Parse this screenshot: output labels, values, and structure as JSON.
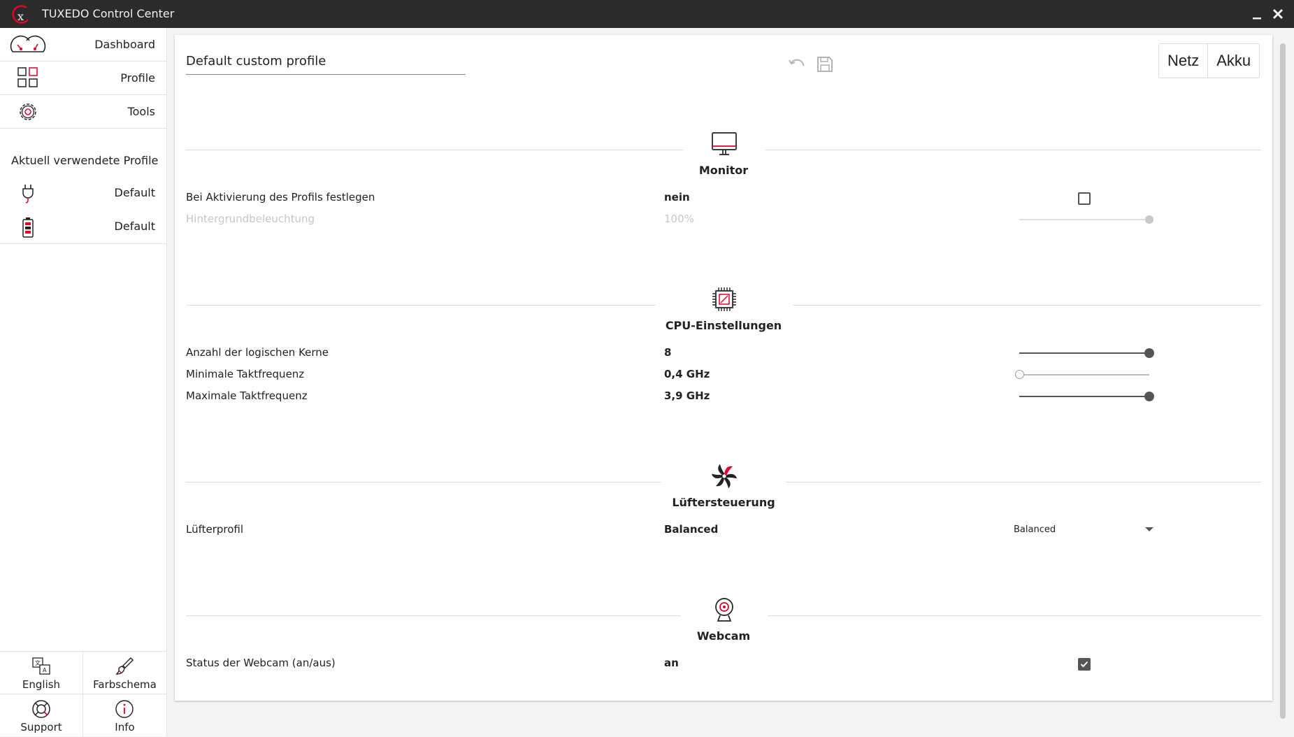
{
  "window": {
    "title": "TUXEDO Control Center",
    "logo_icon": "tuxedo-logo",
    "minimize_icon": "minimize-icon",
    "close_icon": "close-icon"
  },
  "sidebar": {
    "nav": [
      {
        "label": "Dashboard",
        "icon": "dashboard-gauge-icon"
      },
      {
        "label": "Profile",
        "icon": "profiles-grid-icon"
      },
      {
        "label": "Tools",
        "icon": "gear-icon"
      }
    ],
    "profiles_heading": "Aktuell verwendete Profile",
    "profiles": [
      {
        "label": "Default",
        "icon": "power-plug-icon"
      },
      {
        "label": "Default",
        "icon": "battery-icon"
      }
    ],
    "bottom": [
      {
        "label": "English",
        "icon": "language-icon"
      },
      {
        "label": "Farbschema",
        "icon": "paint-brush-icon"
      },
      {
        "label": "Support",
        "icon": "lifebuoy-icon"
      },
      {
        "label": "Info",
        "icon": "info-icon"
      }
    ]
  },
  "main": {
    "profile_name": "Default custom profile",
    "undo_icon": "undo-icon",
    "save_icon": "save-icon",
    "power_toggle": [
      "Netz",
      "Akku"
    ],
    "sections": {
      "monitor": {
        "title": "Monitor",
        "icon": "monitor-icon",
        "rows": [
          {
            "label": "Bei Aktivierung des Profils festlegen",
            "value": "nein",
            "control": "checkbox",
            "checked": false
          },
          {
            "label": "Hintergrundbeleuchtung",
            "value": "100%",
            "control": "slider",
            "level": 1.0,
            "disabled": true
          }
        ]
      },
      "cpu": {
        "title": "CPU-Einstellungen",
        "icon": "cpu-chip-icon",
        "rows": [
          {
            "label": "Anzahl der logischen Kerne",
            "value": "8",
            "control": "slider",
            "level": 1.0
          },
          {
            "label": "Minimale Taktfrequenz",
            "value": "0,4 GHz",
            "control": "slider",
            "level": 0.0
          },
          {
            "label": "Maximale Taktfrequenz",
            "value": "3,9 GHz",
            "control": "slider",
            "level": 1.0
          }
        ]
      },
      "fan": {
        "title": "Lüftersteuerung",
        "icon": "fan-icon",
        "rows": [
          {
            "label": "Lüfterprofil",
            "value": "Balanced",
            "control": "select",
            "selected": "Balanced"
          }
        ]
      },
      "webcam": {
        "title": "Webcam",
        "icon": "webcam-icon",
        "rows": [
          {
            "label": "Status der Webcam (an/aus)",
            "value": "an",
            "control": "checkbox",
            "checked": true
          }
        ]
      }
    }
  },
  "colors": {
    "accent": "#e4002b",
    "titlebar": "#2b2b2b",
    "control": "#555555"
  }
}
